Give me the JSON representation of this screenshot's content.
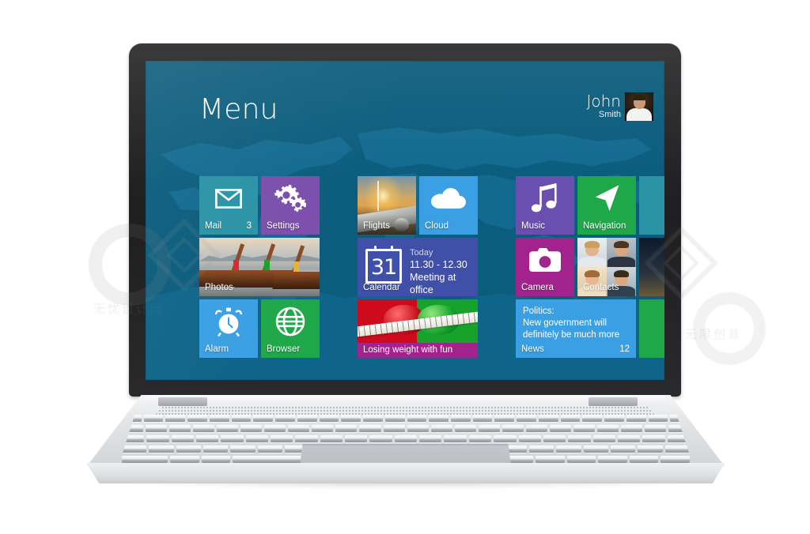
{
  "screen": {
    "title": "Menu",
    "background_color": "#0b5c7d",
    "user": {
      "first_name": "John",
      "last_name": "Smith",
      "avatar": "user-photo"
    }
  },
  "tiles": [
    {
      "id": "mail",
      "label": "Mail",
      "count": "3",
      "color": "#2a93a6",
      "icon": "envelope-icon"
    },
    {
      "id": "settings",
      "label": "Settings",
      "count": "",
      "color": "#7b4fab",
      "icon": "gears-icon"
    },
    {
      "id": "flights",
      "label": "Flights",
      "count": "",
      "color": "#c8922f",
      "icon": "airplane-photo"
    },
    {
      "id": "cloud",
      "label": "Cloud",
      "count": "",
      "color": "#3aa0e3",
      "icon": "cloud-icon"
    },
    {
      "id": "music",
      "label": "Music",
      "count": "",
      "color": "#6a4fb0",
      "icon": "music-note-icon"
    },
    {
      "id": "navigation",
      "label": "Navigation",
      "count": "",
      "color": "#1fa84a",
      "icon": "navigation-arrow-icon"
    },
    {
      "id": "photos",
      "label": "Photos",
      "count": "",
      "color": "#9aa6ad",
      "icon": "boats-photo"
    },
    {
      "id": "calendar",
      "label": "Calendar",
      "count": "",
      "color": "#4050a8",
      "icon": "calendar-icon"
    },
    {
      "id": "camera",
      "label": "Camera",
      "count": "",
      "color": "#a3238e",
      "icon": "camera-icon"
    },
    {
      "id": "contacts",
      "label": "Contacts",
      "count": "",
      "color": "#d8dce0",
      "icon": "people-photos"
    },
    {
      "id": "alarm",
      "label": "Alarm",
      "count": "",
      "color": "#3aa0e3",
      "icon": "alarm-clock-icon"
    },
    {
      "id": "browser",
      "label": "Browser",
      "count": "",
      "color": "#1fa84a",
      "icon": "globe-icon"
    },
    {
      "id": "diet",
      "label": "Losing weight with fun",
      "count": "",
      "color": "#a3238e",
      "icon": "apple-tape-photo"
    },
    {
      "id": "news",
      "label": "News",
      "count": "12",
      "color": "#3aa0e3",
      "icon": "news-text"
    }
  ],
  "calendar_tile": {
    "day": "31",
    "line1": "Today",
    "line2": "11.30 - 12.30",
    "line3": "Meeting at office",
    "label": "Calendar"
  },
  "news_tile": {
    "line1": "Politics:",
    "line2": "New government will",
    "line3": "definitely be much more ...",
    "label": "News",
    "count": "12"
  },
  "diet_tile": {
    "label": "Losing weight with fun"
  },
  "watermark": {
    "text1": "无忧设计网",
    "text2": "无限创意"
  }
}
